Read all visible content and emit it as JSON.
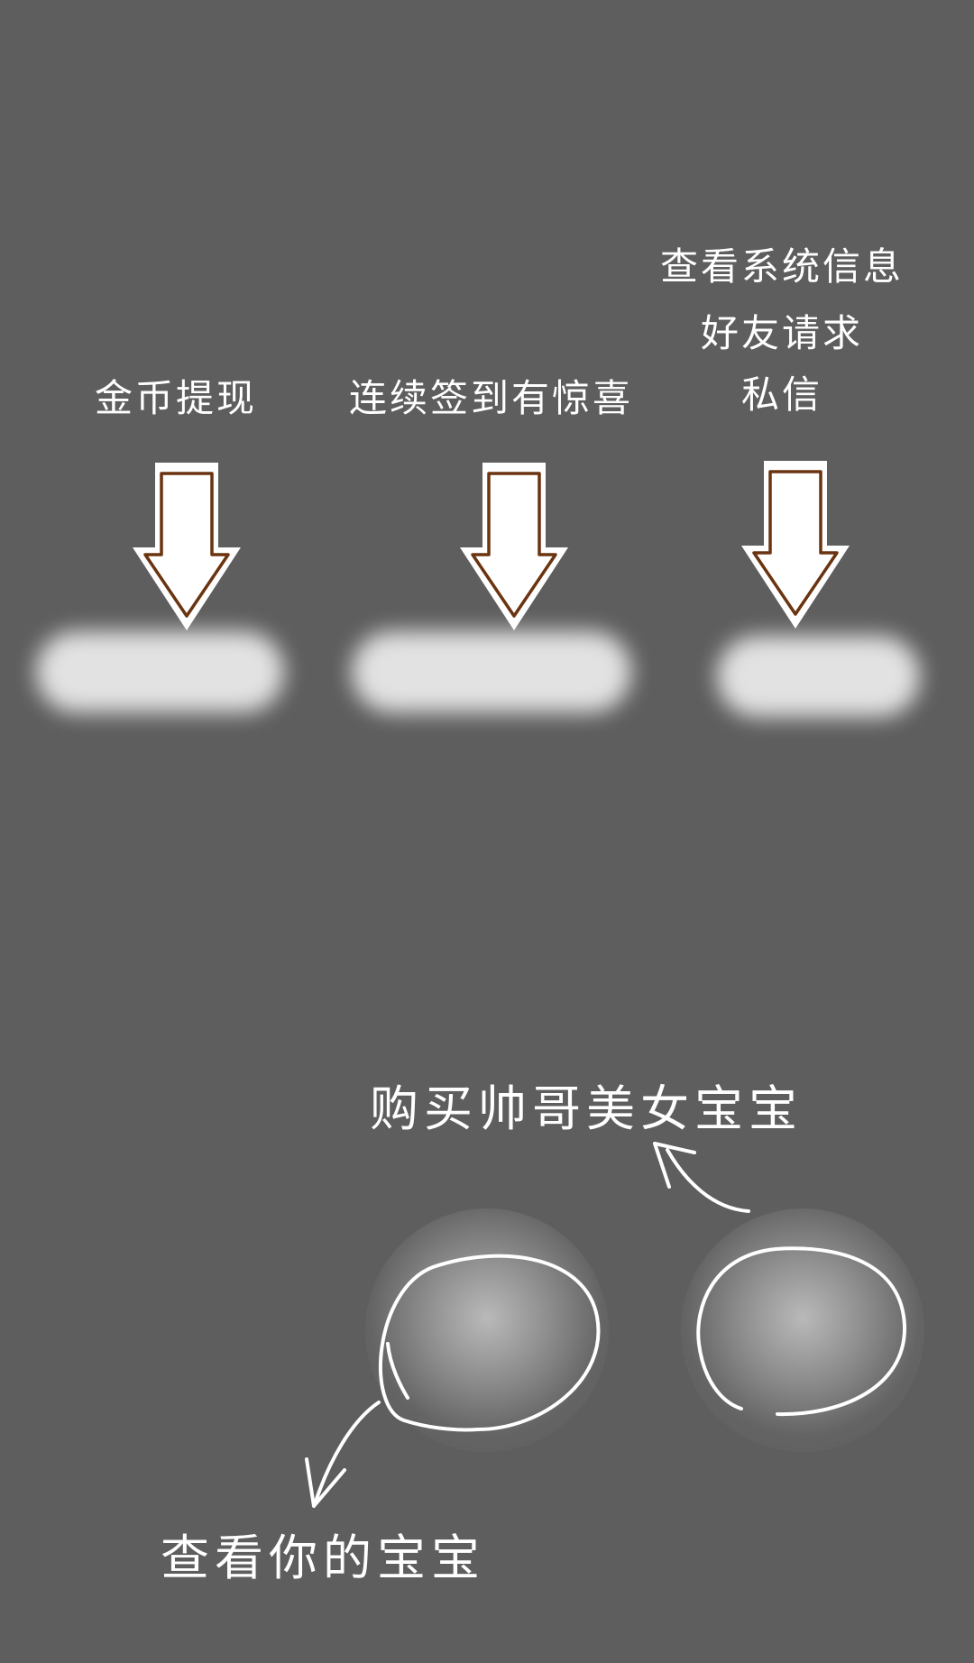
{
  "guide": {
    "top_labels": {
      "withdraw": "金币提现",
      "sign_in": "连续签到有惊喜",
      "system_info": "查看系统信息",
      "friend_request": "好友请求",
      "private_message": "私信"
    },
    "bottom_labels": {
      "buy_babies": "购买帅哥美女宝宝",
      "view_babies": "查看你的宝宝"
    }
  },
  "colors": {
    "background": "#5e5e5e",
    "text": "#ffffff",
    "arrow_fill": "#ffffff",
    "arrow_outline": "#6b3410",
    "highlight": "#e2e2e2"
  },
  "icons": [
    "down-arrow-icon",
    "curved-arrow-icon"
  ]
}
